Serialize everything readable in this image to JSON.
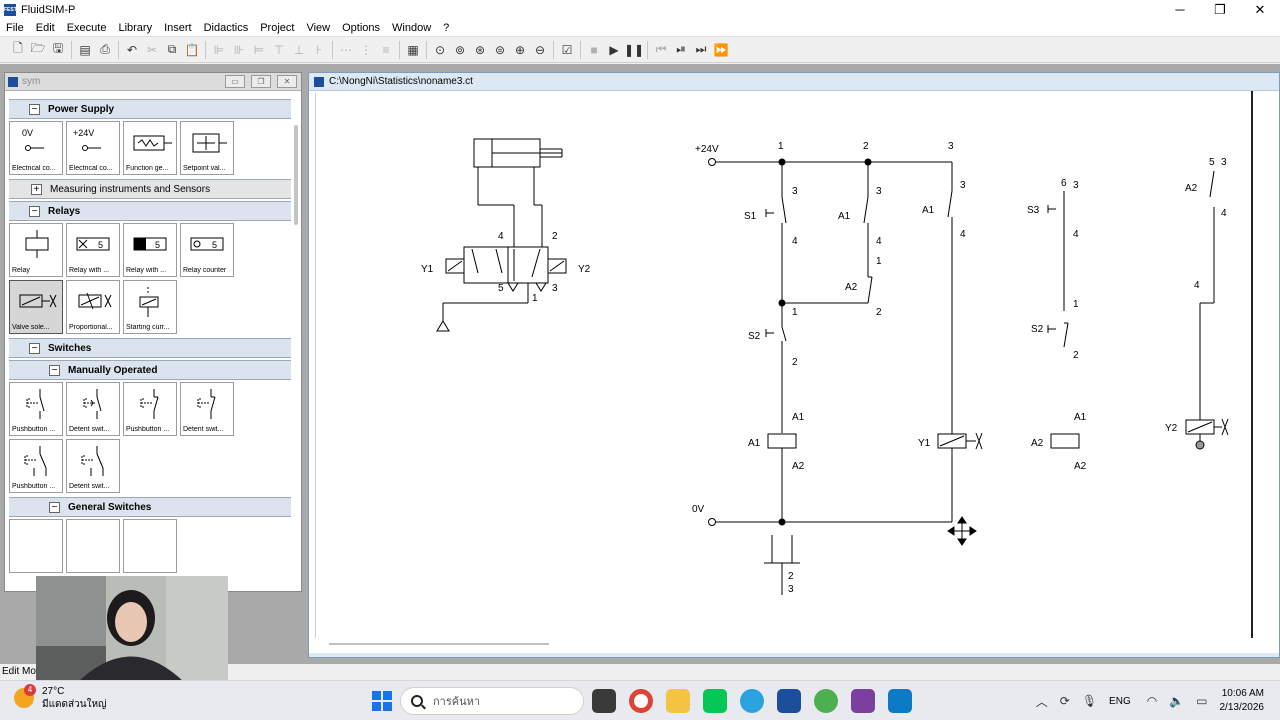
{
  "window": {
    "title": "FluidSIM-P",
    "logo_text": "FESTO"
  },
  "menu": [
    "File",
    "Edit",
    "Execute",
    "Library",
    "Insert",
    "Didactics",
    "Project",
    "View",
    "Options",
    "Window",
    "?"
  ],
  "library": {
    "title": "sym",
    "groups": {
      "power_supply": "Power Supply",
      "measuring": "Measuring instruments and Sensors",
      "relays": "Relays",
      "switches": "Switches",
      "manually_operated": "Manually Operated",
      "general_switches": "General Switches"
    },
    "power_items": {
      "i0": {
        "label": "Electrical co...",
        "glyph": "0V"
      },
      "i1": {
        "label": "Electrical co...",
        "glyph": "+24V"
      },
      "i2": {
        "label": "Function ge..."
      },
      "i3": {
        "label": "Setpoint val..."
      }
    },
    "relay_items": {
      "i0": {
        "label": "Relay"
      },
      "i1": {
        "label": "Relay with ...",
        "glyph": "5"
      },
      "i2": {
        "label": "Relay with ...",
        "glyph": "5"
      },
      "i3": {
        "label": "Relay counter",
        "glyph": "5"
      },
      "i4": {
        "label": "Valve sole..."
      },
      "i5": {
        "label": "Proportional..."
      },
      "i6": {
        "label": "Starting curr..."
      }
    },
    "manual_items": {
      "i0": {
        "label": "Pushbutton ..."
      },
      "i1": {
        "label": "Detent swit..."
      },
      "i2": {
        "label": "Pushbutton ..."
      },
      "i3": {
        "label": "Detent swit..."
      },
      "i4": {
        "label": "Pushbutton ..."
      },
      "i5": {
        "label": "Detent swit..."
      }
    }
  },
  "circuit_window": {
    "title": "C:\\NongNi\\Statistics\\noname3.ct"
  },
  "circuit": {
    "supply_pos": "+24V",
    "supply_neg": "0V",
    "valve": {
      "y1": "Y1",
      "y2": "Y2",
      "p4": "4",
      "p2": "2",
      "p5": "5",
      "p3": "3",
      "p1": "1"
    },
    "rungs": {
      "r1": "1",
      "r2": "2",
      "r3": "3"
    },
    "s1": "S1",
    "s2": "S2",
    "s3": "S3",
    "a1": "A1",
    "a2": "A2",
    "y1": "Y1",
    "y2": "Y2",
    "pins": {
      "n1": "1",
      "n2": "2",
      "n3": "3",
      "n4": "4",
      "n5": "5",
      "n6": "6"
    }
  },
  "status_bar": "Edit Mode",
  "taskbar": {
    "weather_temp": "27°C",
    "weather_desc": "มีแดดส่วนใหญ่",
    "weather_badge": "4",
    "search_placeholder": "การค้นหา",
    "language": "ENG",
    "time": "10:06 AM",
    "date": "2/13/2026"
  },
  "colors": {
    "accent": "#1b4f9c",
    "chrome_blue": "#dde8f5",
    "group_header": "#dbe4ee",
    "desktop_grey": "#a9a9a9"
  },
  "icons": [
    "new-icon",
    "open-icon",
    "save-icon",
    "print-icon",
    "undo-icon",
    "cut-icon",
    "copy-icon",
    "paste-icon",
    "zoom-icon",
    "play-icon",
    "pause-icon",
    "stop-icon",
    "search-icon",
    "wifi-icon",
    "volume-icon",
    "battery-icon"
  ]
}
